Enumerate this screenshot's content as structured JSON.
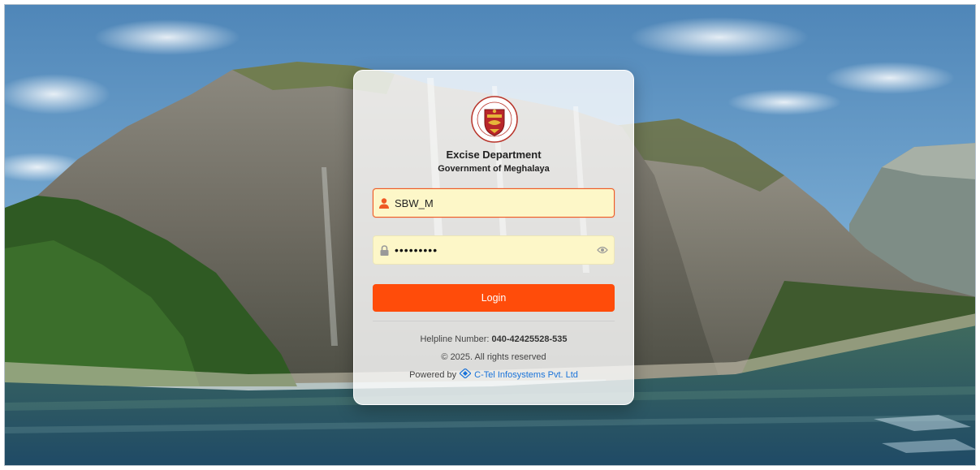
{
  "header": {
    "title": "Excise Department",
    "subtitle": "Government of Meghalaya"
  },
  "logo": {
    "icon": "excise-department-emblem-icon",
    "ring_text": "EXCISE DEPARTMENT · GOVT. OF MEGHALAYA"
  },
  "form": {
    "username": {
      "value": "SBW_M",
      "icon": "user-icon"
    },
    "password": {
      "value": "•••••••••",
      "icon": "lock-icon",
      "toggle_icon": "eye-icon"
    },
    "login_label": "Login"
  },
  "footer": {
    "helpline_label": "Helpline Number:",
    "helpline_number": "040-42425528-535",
    "copyright": "© 2025. All rights reserved",
    "powered_by_label": "Powered by",
    "powered_by_company": "C-Tel Infosystems Pvt. Ltd"
  },
  "colors": {
    "accent": "#ff4c0a",
    "field_bg": "#fdf7c8",
    "link": "#1a73d9"
  }
}
